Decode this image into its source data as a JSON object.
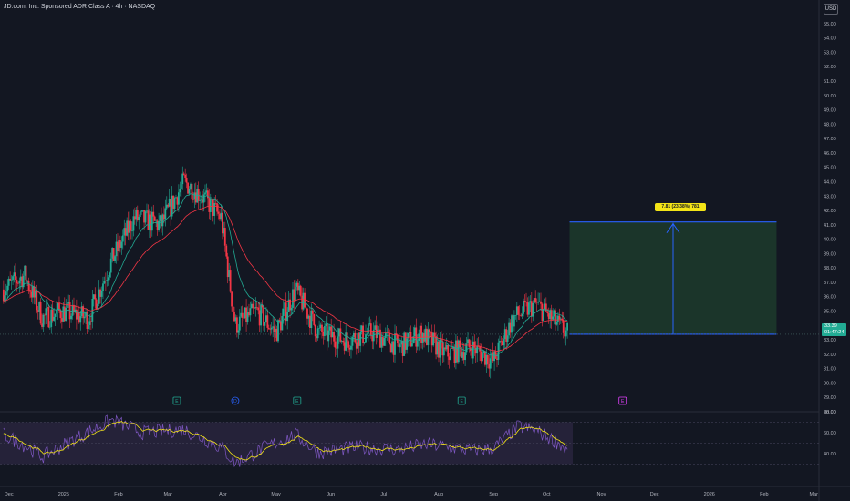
{
  "header": {
    "symbol_title": "JD.com, Inc. Sponsored ADR Class A · 4h · NASDAQ",
    "currency": "USD"
  },
  "last_price": {
    "value": "33.39",
    "countdown": "01:47:24"
  },
  "target": {
    "label": "7.81 (23.38%) 781"
  },
  "colors": {
    "background": "#131722",
    "up_candle": "#22ab94",
    "down_candle": "#f23645",
    "ema_fast": "#22ab94",
    "ema_slow": "#f23645",
    "target_zone": "#1d3b2b",
    "target_line": "#2962ff",
    "rsi_line": "#7e57c2",
    "rsi_ma": "#f3e417",
    "rsi_band": "#2a2640"
  },
  "chart_data": {
    "type": "candlestick",
    "title": "JD.com, Inc. Sponsored ADR Class A · 4h · NASDAQ",
    "ylim": [
      28,
      55.5
    ],
    "y_axis_ticks": [
      "55.00",
      "54.00",
      "53.00",
      "52.00",
      "51.00",
      "50.00",
      "49.00",
      "48.00",
      "47.00",
      "46.00",
      "45.00",
      "44.00",
      "43.00",
      "42.00",
      "41.00",
      "40.00",
      "39.00",
      "38.00",
      "37.00",
      "36.00",
      "35.00",
      "34.00",
      "33.00",
      "32.00",
      "31.00",
      "30.00",
      "29.00",
      "28.00"
    ],
    "x_axis_ticks": [
      "Dec",
      "2025",
      "Feb",
      "Mar",
      "Apr",
      "May",
      "Jun",
      "Jul",
      "Aug",
      "Sep",
      "Oct",
      "Nov",
      "Dec",
      "2026",
      "Feb",
      "Mar"
    ],
    "price_path": [
      [
        "2024-11-28",
        36.5
      ],
      [
        "2024-12-10",
        37.5
      ],
      [
        "2024-12-20",
        34.5
      ],
      [
        "2024-12-31",
        35.0
      ],
      [
        "2025-01-15",
        34.5
      ],
      [
        "2025-01-28",
        38.5
      ],
      [
        "2025-02-10",
        41.5
      ],
      [
        "2025-02-25",
        41.0
      ],
      [
        "2025-03-10",
        44.0
      ],
      [
        "2025-03-20",
        43.0
      ],
      [
        "2025-03-31",
        41.5
      ],
      [
        "2025-04-08",
        34.0
      ],
      [
        "2025-04-20",
        35.0
      ],
      [
        "2025-05-01",
        33.5
      ],
      [
        "2025-05-12",
        36.5
      ],
      [
        "2025-05-25",
        33.5
      ],
      [
        "2025-06-10",
        33.0
      ],
      [
        "2025-06-25",
        33.5
      ],
      [
        "2025-07-10",
        32.5
      ],
      [
        "2025-07-22",
        33.5
      ],
      [
        "2025-08-05",
        32.0
      ],
      [
        "2025-08-20",
        32.5
      ],
      [
        "2025-09-01",
        31.5
      ],
      [
        "2025-09-12",
        34.5
      ],
      [
        "2025-09-25",
        35.5
      ],
      [
        "2025-10-08",
        34.0
      ],
      [
        "2025-10-13",
        33.39
      ]
    ],
    "rsi": {
      "ylim": [
        20,
        80
      ],
      "y_axis_ticks": [
        "80.00",
        "60.00",
        "40.00"
      ],
      "band": [
        30,
        70
      ],
      "path": [
        [
          "2024-11-28",
          58
        ],
        [
          "2024-12-10",
          48
        ],
        [
          "2024-12-20",
          37
        ],
        [
          "2025-01-05",
          52
        ],
        [
          "2025-01-28",
          72
        ],
        [
          "2025-02-15",
          60
        ],
        [
          "2025-03-10",
          63
        ],
        [
          "2025-03-31",
          46
        ],
        [
          "2025-04-08",
          31
        ],
        [
          "2025-04-25",
          46
        ],
        [
          "2025-05-12",
          58
        ],
        [
          "2025-05-25",
          41
        ],
        [
          "2025-06-15",
          46
        ],
        [
          "2025-07-10",
          44
        ],
        [
          "2025-07-25",
          49
        ],
        [
          "2025-08-20",
          43
        ],
        [
          "2025-09-01",
          45
        ],
        [
          "2025-09-15",
          66
        ],
        [
          "2025-09-25",
          62
        ],
        [
          "2025-10-08",
          50
        ],
        [
          "2025-10-13",
          42
        ]
      ]
    },
    "events": [
      {
        "label": "E",
        "date": "2025-03-06"
      },
      {
        "label": "D",
        "date": "2025-04-08"
      },
      {
        "label": "E",
        "date": "2025-05-13"
      },
      {
        "label": "E",
        "date": "2025-08-14"
      },
      {
        "label": "E",
        "date": "2025-11-13"
      }
    ],
    "target_zone": {
      "from": "2025-10-14",
      "to": "2026-02-08",
      "low": 33.39,
      "high": 41.2
    },
    "grid": false,
    "legend": "none"
  }
}
